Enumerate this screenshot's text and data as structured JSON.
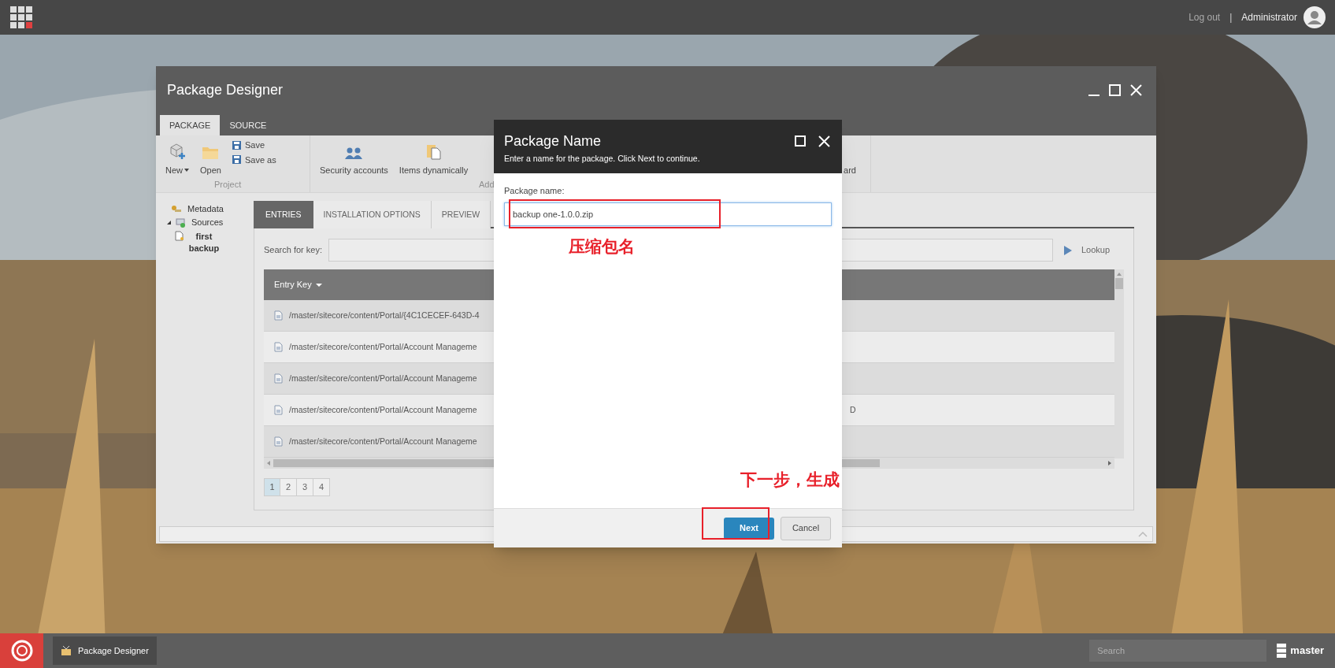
{
  "top_bar": {
    "logout": "Log out",
    "separator": "|",
    "user": "Administrator"
  },
  "window": {
    "title": "Package Designer",
    "tabs": [
      {
        "label": "PACKAGE",
        "selected": true
      },
      {
        "label": "SOURCE",
        "selected": false
      }
    ],
    "ribbon": [
      {
        "label": "Project",
        "buttons": [
          {
            "kind": "large",
            "label": "New",
            "dropdown": true
          },
          {
            "kind": "large",
            "label": "Open"
          },
          {
            "kind": "stack",
            "items": [
              "Save",
              "Save as"
            ]
          }
        ]
      },
      {
        "label": "Add",
        "buttons": [
          {
            "kind": "large",
            "label": "Security accounts"
          },
          {
            "kind": "large",
            "label": "Items dynamically"
          },
          {
            "kind": "partial",
            "label": "ard"
          }
        ]
      }
    ],
    "tree": [
      {
        "label": "Metadata"
      },
      {
        "label": "Sources",
        "expanded": true,
        "children": [
          {
            "label": "first backup"
          }
        ]
      }
    ],
    "content_tabs": [
      {
        "label": "ENTRIES",
        "selected": true
      },
      {
        "label": "INSTALLATION OPTIONS",
        "selected": false
      },
      {
        "label": "PREVIEW",
        "selected": false
      }
    ],
    "search": {
      "label": "Search for key:",
      "button": "Lookup"
    },
    "table": {
      "columns": [
        "Entry Key"
      ],
      "rows": [
        {
          "key": "/master/sitecore/content/Portal/{4C1CECEF-643D-4"
        },
        {
          "key": "/master/sitecore/content/Portal/Account Manageme"
        },
        {
          "key": "/master/sitecore/content/Portal/Account Manageme"
        },
        {
          "key": "/master/sitecore/content/Portal/Account Manageme",
          "column_2": "D"
        },
        {
          "key": "/master/sitecore/content/Portal/Account Manageme"
        }
      ]
    },
    "pages": [
      {
        "label": "1",
        "selected": true
      },
      {
        "label": "2",
        "selected": false
      },
      {
        "label": "3",
        "selected": false
      },
      {
        "label": "4",
        "selected": false
      }
    ]
  },
  "dialog": {
    "title": "Package Name",
    "subtitle": "Enter a name for the package. Click Next to continue.",
    "field_label": "Package name:",
    "value": "backup one-1.0.0.zip",
    "buttons": [
      {
        "label": "Next",
        "primary": true
      },
      {
        "label": "Cancel",
        "primary": false
      }
    ]
  },
  "annotations": [
    {
      "text": "压缩包名"
    },
    {
      "text": "下一步，生成"
    }
  ],
  "taskbar": {
    "app": "Package Designer",
    "search_placeholder": "Search",
    "database": "master"
  }
}
